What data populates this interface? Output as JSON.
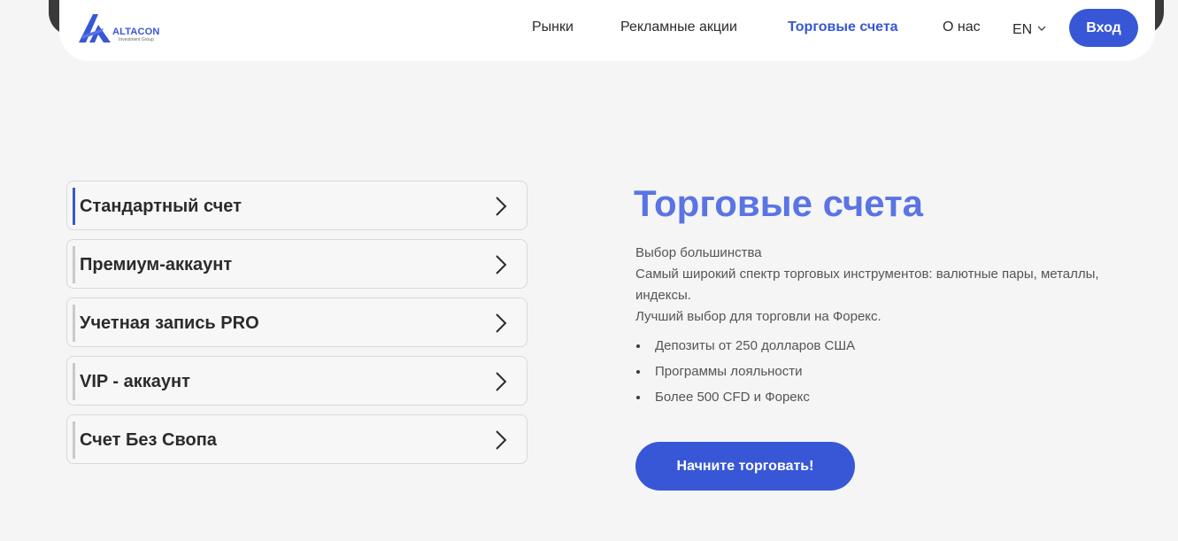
{
  "brand": {
    "name": "ALTACON",
    "tagline": "Investment Group",
    "color": "#3757d6"
  },
  "nav": {
    "links": [
      {
        "label": "Рынки",
        "active": false
      },
      {
        "label": "Рекламные акции",
        "active": false
      },
      {
        "label": "Торговые счета",
        "active": true
      },
      {
        "label": "О нас",
        "active": false
      }
    ],
    "language": "EN",
    "login_label": "Вход"
  },
  "accounts": [
    {
      "label": "Стандартный счет",
      "active": true
    },
    {
      "label": "Премиум-аккаунт",
      "active": false
    },
    {
      "label": "Учетная запись PRO",
      "active": false
    },
    {
      "label": "VIP - аккаунт",
      "active": false
    },
    {
      "label": "Счет Без Свопа",
      "active": false
    }
  ],
  "main": {
    "title": "Торговые счета",
    "description": [
      "Выбор большинства",
      "Самый широкий спектр торговых инструментов: валютные пары, металлы, индексы.",
      "Лучший выбор для торговли на Форекс."
    ],
    "features": [
      "Депозиты от 250 долларов США",
      "Программы лояльности",
      "Более 500 CFD и Форекс"
    ],
    "cta_label": "Начните торговать!"
  },
  "icons": {
    "logo": "altacon-logo-icon",
    "chevron": "chevron-right-icon",
    "dropdown": "chevron-down-icon"
  }
}
